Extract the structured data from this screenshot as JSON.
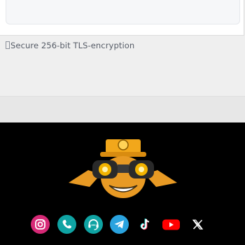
{
  "security_note": {
    "icon": "lock-icon",
    "text": "Secure 256-bit TLS-encryption"
  },
  "footer": {
    "logo": "binoculars-mascot-logo",
    "socials": [
      {
        "name": "instagram",
        "icon": "instagram-icon",
        "color": "#d62976"
      },
      {
        "name": "phone",
        "icon": "phone-icon",
        "color": "#0fa3a3"
      },
      {
        "name": "support",
        "icon": "headset-icon",
        "color": "#0fa3a3"
      },
      {
        "name": "telegram",
        "icon": "telegram-icon",
        "color": "#2aa3df"
      },
      {
        "name": "tiktok",
        "icon": "tiktok-icon",
        "color": "#ffffff"
      },
      {
        "name": "youtube",
        "icon": "youtube-icon",
        "color": "#ff0000"
      },
      {
        "name": "x",
        "icon": "x-icon",
        "color": "#ffffff"
      }
    ]
  }
}
